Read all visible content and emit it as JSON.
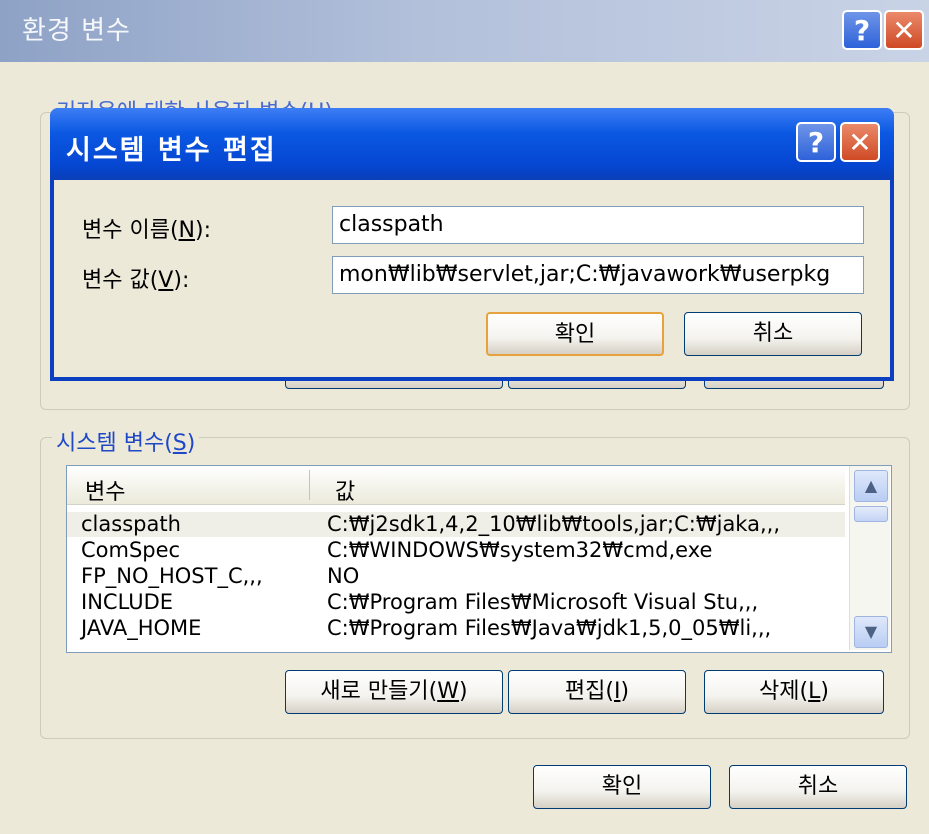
{
  "env_window": {
    "title": "환경 변수",
    "user_group_label": "기자온에 대한 사용자 변수(U)",
    "system_group_label": "시스템 변수(S)",
    "list": {
      "headers": [
        "변수",
        "값"
      ],
      "rows": [
        {
          "name": "classpath",
          "value": "C:₩j2sdk1,4,2_10₩lib₩tools,jar;C:₩jaka,,,",
          "selected": true
        },
        {
          "name": "ComSpec",
          "value": "C:₩WINDOWS₩system32₩cmd,exe",
          "selected": false
        },
        {
          "name": "FP_NO_HOST_C,,,",
          "value": "NO",
          "selected": false
        },
        {
          "name": "INCLUDE",
          "value": "C:₩Program Files₩Microsoft Visual Stu,,,",
          "selected": false
        },
        {
          "name": "JAVA_HOME",
          "value": "C:₩Program Files₩Java₩jdk1,5,0_05₩li,,,",
          "selected": false
        }
      ]
    },
    "system_buttons": {
      "new": "새로 만들기(W)",
      "edit": "편집(I)",
      "delete": "삭제(L)"
    },
    "footer_buttons": {
      "ok": "확인",
      "cancel": "취소"
    }
  },
  "edit_dialog": {
    "title": "시스템 변수 편집",
    "name_label": "변수 이름(N):",
    "name_value": "classpath",
    "value_label": "변수 값(V):",
    "value_value": "mon₩lib₩servlet,jar;C:₩javawork₩userpkg",
    "ok": "확인",
    "cancel": "취소"
  },
  "icons": {
    "help": "help-icon",
    "close": "close-icon",
    "scroll_up": "chevron-up-icon",
    "scroll_down": "chevron-down-icon"
  },
  "colors": {
    "inner_title": "#0b58e2",
    "outer_title": "#b2c0da",
    "group_label": "#1f48c8",
    "window_bg": "#ece9d8"
  }
}
